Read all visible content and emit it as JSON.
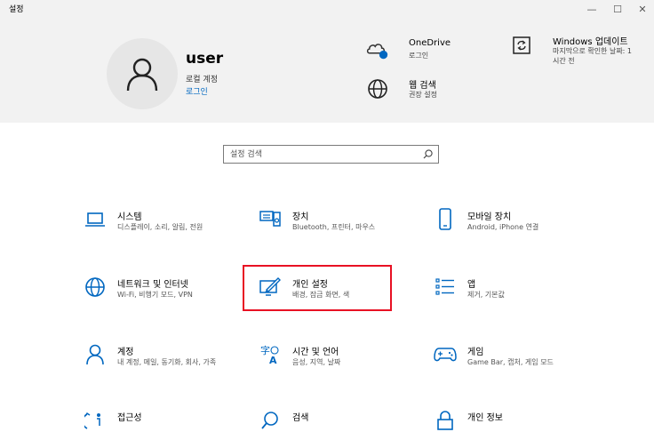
{
  "window": {
    "title": "설정",
    "minimize": "—",
    "maximize": "☐",
    "close": "✕"
  },
  "account": {
    "name": "user",
    "type": "로컬 계정",
    "sign_in": "로그인"
  },
  "header_items": {
    "onedrive": {
      "title": "OneDrive",
      "subtitle": "로그인"
    },
    "web_search": {
      "title": "웹 검색",
      "subtitle": "권장 설정"
    },
    "windows_update": {
      "title": "Windows 업데이트",
      "subtitle": "마지막으로 확인한 날짜: 1시간 전"
    }
  },
  "search": {
    "placeholder": "설정 검색"
  },
  "categories": {
    "system": {
      "name": "시스템",
      "desc": "디스플레이, 소리, 알림, 전원"
    },
    "devices": {
      "name": "장치",
      "desc": "Bluetooth, 프린터, 마우스"
    },
    "phone": {
      "name": "모바일 장치",
      "desc": "Android, iPhone 연결"
    },
    "network": {
      "name": "네트워크 및 인터넷",
      "desc": "Wi-Fi, 비행기 모드, VPN"
    },
    "personalization": {
      "name": "개인 설정",
      "desc": "배경, 잠금 화면, 색"
    },
    "apps": {
      "name": "앱",
      "desc": "제거, 기본값"
    },
    "accounts": {
      "name": "계정",
      "desc": "내 계정, 메일, 동기화, 회사, 가족"
    },
    "time_language": {
      "name": "시간 및 언어",
      "desc": "음성, 지역, 날짜"
    },
    "gaming": {
      "name": "게임",
      "desc": "Game Bar, 캡처, 게임 모드"
    },
    "ease_of_access": {
      "name": "접근성",
      "desc": ""
    },
    "search_cat": {
      "name": "검색",
      "desc": ""
    },
    "privacy": {
      "name": "개인 정보",
      "desc": ""
    }
  },
  "colors": {
    "accent": "#0067c0",
    "highlight": "#e81123",
    "header_bg": "#f2f2f2"
  }
}
